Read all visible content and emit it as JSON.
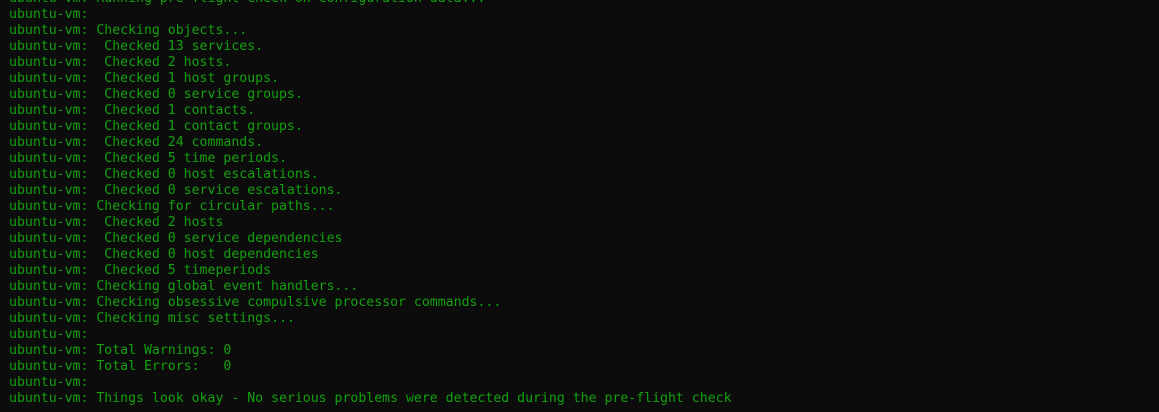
{
  "terminal": {
    "text_color": "#13a10e",
    "background_color": "#0c0c0c",
    "prompt": "ubuntu-vm:",
    "lines": [
      " Running pre-flight check on configuration data...",
      "",
      " Checking objects...",
      "  Checked 13 services.",
      "  Checked 2 hosts.",
      "  Checked 1 host groups.",
      "  Checked 0 service groups.",
      "  Checked 1 contacts.",
      "  Checked 1 contact groups.",
      "  Checked 24 commands.",
      "  Checked 5 time periods.",
      "  Checked 0 host escalations.",
      "  Checked 0 service escalations.",
      " Checking for circular paths...",
      "  Checked 2 hosts",
      "  Checked 0 service dependencies",
      "  Checked 0 host dependencies",
      "  Checked 5 timeperiods",
      " Checking global event handlers...",
      " Checking obsessive compulsive processor commands...",
      " Checking misc settings...",
      "",
      " Total Warnings: 0",
      " Total Errors:   0",
      "",
      " Things look okay - No serious problems were detected during the pre-flight check"
    ]
  }
}
